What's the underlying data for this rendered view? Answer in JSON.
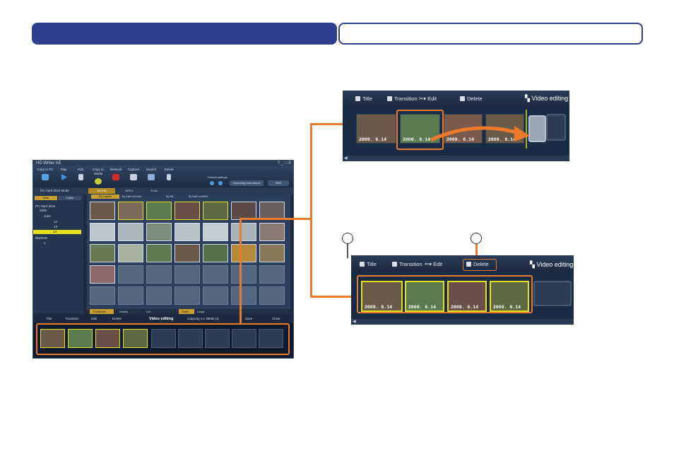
{
  "colors": {
    "header_blue": "#2d3f8e",
    "callout_orange": "#ec7a2b",
    "selection_yellow": "#e8e01c",
    "app_bg": "#1e2c42"
  },
  "app": {
    "title": "HD Writer AE",
    "window_controls": "? _ □ X",
    "toolbar": [
      {
        "label": "Copy to PC",
        "icon": "copy-icon"
      },
      {
        "label": "Play",
        "icon": "play-icon"
      },
      {
        "label": "Edit",
        "icon": "scissors-icon"
      },
      {
        "label": "Copy to Media",
        "icon": "disc-icon"
      },
      {
        "label": "Network",
        "icon": "youtube-icon"
      },
      {
        "label": "Capture",
        "icon": "camera-icon"
      },
      {
        "label": "Search",
        "icon": "search-icon"
      },
      {
        "label": "Delete",
        "icon": "trash-icon"
      }
    ],
    "default_settings": "Default settings",
    "operating_instructions": "Operating instructions",
    "exit": "Exit",
    "mode_label": "PC Hard drive Mode",
    "mode_tabs": [
      "AVCHD",
      "MPEG",
      "Photo"
    ],
    "sidebar_tabs": [
      "Date",
      "Folder"
    ],
    "tree": [
      "PC Hard drive",
      "2009",
      "June",
      "12",
      "13",
      "14",
      "BD/DVD",
      "1"
    ],
    "sort_tabs": [
      "By Capture",
      "By Date recorded",
      "By title",
      "By Date modified"
    ],
    "view_bar": [
      "Thumbnail",
      "Details",
      "List",
      "Small",
      "Large"
    ],
    "edit_bar": {
      "title": "Title",
      "transition": "Transition",
      "edit": "Edit",
      "delete": "Delete",
      "video_editing": "Video editing",
      "capacity": "Capacity 4.1 36MB (4)",
      "save": "Save",
      "close": "Close"
    }
  },
  "zoom_top": {
    "title": "Title",
    "transition": "Transition",
    "edit": "Edit",
    "delete": "Delete",
    "video_editing": "Video editing",
    "dates": [
      "2009. 6.14",
      "2009. 6.14",
      "2009. 6.14",
      "2009. 6.14"
    ]
  },
  "zoom_bottom": {
    "title": "Title",
    "transition": "Transition",
    "edit": "Edit",
    "delete": "Delete",
    "video_editing": "Video editing",
    "dates": [
      "2009. 6.14",
      "2009. 6.14",
      "2009. 6.14",
      "2009. 6.14"
    ]
  }
}
